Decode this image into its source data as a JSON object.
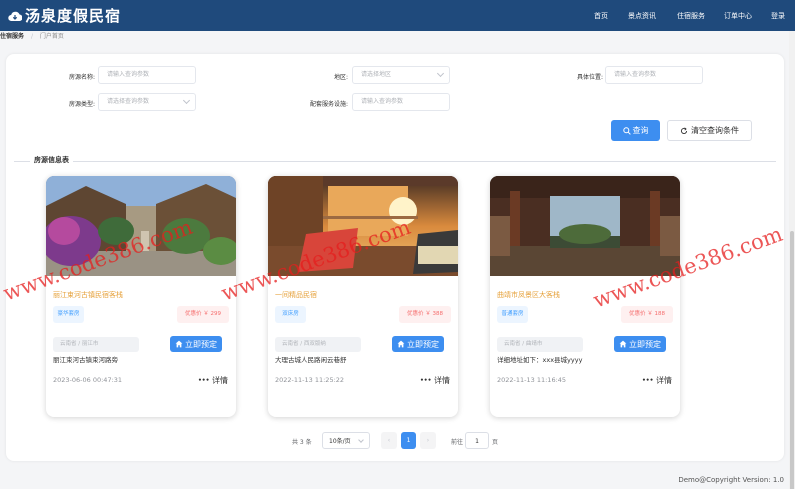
{
  "header": {
    "brand": "汤泉度假民宿",
    "nav": [
      "首页",
      "景点资讯",
      "住宿服务",
      "订单中心",
      "登录"
    ]
  },
  "breadcrumb": {
    "items": [
      "住宿服务",
      "门户首页"
    ],
    "separator": "/"
  },
  "search": {
    "fields": [
      {
        "label": "房源名称:",
        "placeholder": "请输入查询参数"
      },
      {
        "label": "地区:",
        "placeholder": "请选择地区"
      },
      {
        "label": "具体位置:",
        "placeholder": "请输入查询参数"
      },
      {
        "label": "房源类型:",
        "placeholder": "请选择查询参数"
      },
      {
        "label": "配套服务设施:",
        "placeholder": "请输入查询参数"
      }
    ],
    "query_label": "查询",
    "clear_label": "清空查询条件"
  },
  "section_title": "房源信息表",
  "cards": [
    {
      "title": "丽江束河古镇民宿客栈",
      "tag": "豪华套房",
      "price": "优惠价 ￥ 299",
      "location": "云南省 / 丽江市",
      "book_label": "立即预定",
      "address": "丽江束河古镇束河路旁",
      "time": "2023-06-06 00:47:31",
      "more_label": "详情",
      "image": "courtyard-flowers"
    },
    {
      "title": "一间精品民宿",
      "tag": "双床房",
      "price": "优惠价 ￥ 388",
      "location": "云南省 / 西双版纳",
      "book_label": "立即预定",
      "address": "大理古城人民路闲云巷舒",
      "time": "2022-11-13 11:25:22",
      "more_label": "详情",
      "image": "sunset-balcony"
    },
    {
      "title": "曲靖市凤景区大客栈",
      "tag": "普通套房",
      "price": "优惠价 ￥ 188",
      "location": "云南省 / 曲靖市",
      "book_label": "立即预定",
      "address": "详细地址如下：xxx县城yyyy",
      "time": "2022-11-13 11:16:45",
      "more_label": "详情",
      "image": "wooden-courtyard"
    }
  ],
  "pagination": {
    "total": "共 3 条",
    "page_size": "10条/页",
    "current": "1",
    "goto_label": "前往",
    "goto_value": "1",
    "page_suffix": "页"
  },
  "watermark": "www.code386.com",
  "footer": "Demo@Copyright Version: 1.0",
  "colors": {
    "header": "#1f4a7c",
    "primary": "#3d8ef0",
    "title_orange": "#e6a23c",
    "price_red": "#f56c6c"
  }
}
